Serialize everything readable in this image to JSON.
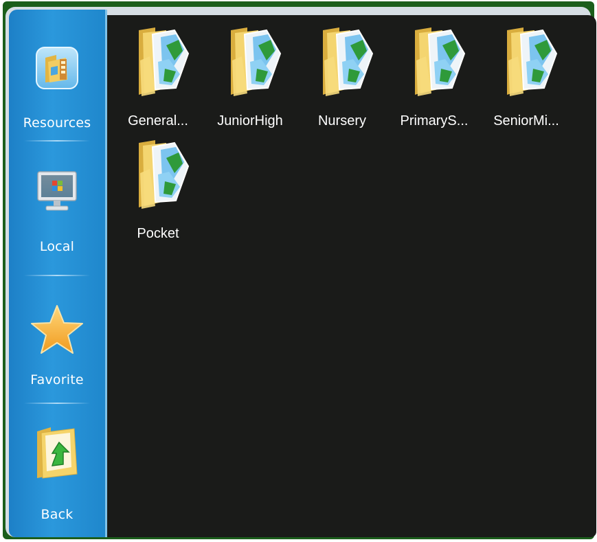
{
  "sidebar": {
    "items": [
      {
        "label": "Resources",
        "icon": "resources-folder-icon"
      },
      {
        "label": "Local",
        "icon": "monitor-icon"
      },
      {
        "label": "Favorite",
        "icon": "star-icon"
      },
      {
        "label": "Back",
        "icon": "back-arrow-folder-icon"
      }
    ]
  },
  "content": {
    "folders": [
      {
        "label": "General..."
      },
      {
        "label": "JuniorHigh"
      },
      {
        "label": "Nursery"
      },
      {
        "label": "PrimaryS..."
      },
      {
        "label": "SeniorMi..."
      },
      {
        "label": "Pocket"
      }
    ]
  },
  "colors": {
    "sidebar": "#2b98dc",
    "content_bg": "#1a1b19",
    "window_frame": "#1b5e1b",
    "folder_yellow": "#f3d36a",
    "picture_green": "#2f9a3a",
    "star": "#f3a928"
  }
}
